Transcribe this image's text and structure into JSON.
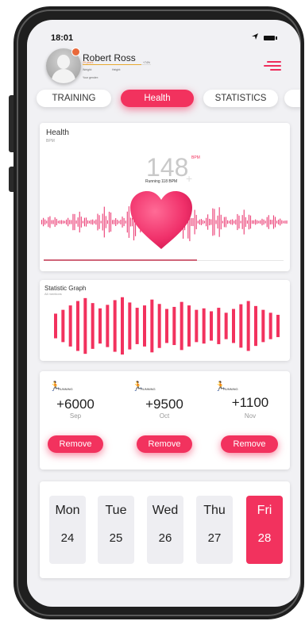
{
  "status_bar": {
    "time": "18:01",
    "arrow_icon": "location-arrow-icon",
    "battery_icon": "battery-icon"
  },
  "profile": {
    "name": "Robert Ross",
    "meta_line1": "29 years",
    "meta_line1_right": "+74%",
    "meta_weight": "Weight:",
    "meta_height": "Height:",
    "meta_gender": "Your gender:"
  },
  "tabs": [
    {
      "label": "TRAINING",
      "active": false
    },
    {
      "label": "Health",
      "active": true
    },
    {
      "label": "STATISTICS",
      "active": false
    }
  ],
  "health_card": {
    "title": "Health",
    "subtitle": "BPM",
    "bpm_value": "148",
    "bpm_unit": "BPM",
    "bpm_caption": "Running 118 BPM",
    "progress": 0.64
  },
  "statistic_card": {
    "title": "Statistic Graph",
    "subtitle": "All mentions",
    "bar_levels": [
      0.42,
      0.55,
      0.7,
      0.85,
      0.95,
      0.78,
      0.6,
      0.72,
      0.88,
      0.98,
      0.8,
      0.62,
      0.7,
      0.9,
      0.75,
      0.58,
      0.65,
      0.82,
      0.7,
      0.55,
      0.6,
      0.5,
      0.62,
      0.45,
      0.58,
      0.74,
      0.85,
      0.68,
      0.55,
      0.45,
      0.38
    ]
  },
  "running": [
    {
      "icon": "running-person-icon",
      "tag": "RUNNING",
      "value": "+6000",
      "month": "Sep",
      "button": "Remove"
    },
    {
      "icon": "running-person-icon",
      "tag": "RUNNING",
      "value": "+9500",
      "month": "Oct",
      "button": "Remove"
    },
    {
      "icon": "running-person-icon",
      "tag": "RUNNING",
      "value": "+1100",
      "month": "Nov",
      "button": "Remove"
    }
  ],
  "days": [
    {
      "name": "Mon",
      "date": "24",
      "active": false
    },
    {
      "name": "Tue",
      "date": "25",
      "active": false
    },
    {
      "name": "Wed",
      "date": "26",
      "active": false
    },
    {
      "name": "Thu",
      "date": "27",
      "active": false
    },
    {
      "name": "Fri",
      "date": "28",
      "active": true
    }
  ],
  "colors": {
    "accent": "#f2325e",
    "background": "#f1f1f4",
    "frame": "#1f1f1f"
  }
}
